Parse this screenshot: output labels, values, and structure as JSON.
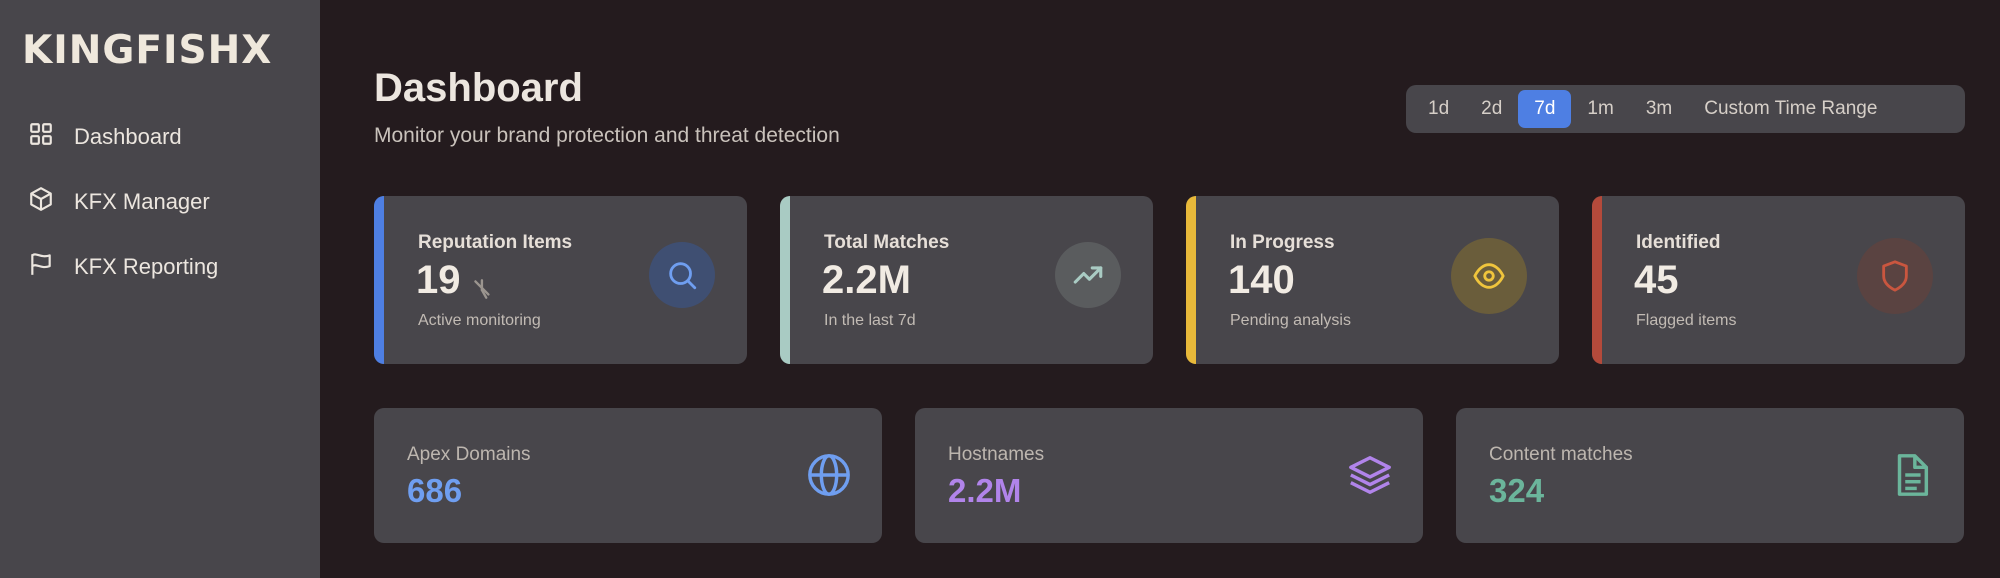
{
  "brand": {
    "logo_text": "KINGFISHX"
  },
  "sidebar": {
    "items": [
      {
        "label": "Dashboard",
        "icon": "grid-icon"
      },
      {
        "label": "KFX Manager",
        "icon": "cube-icon"
      },
      {
        "label": "KFX Reporting",
        "icon": "flag-icon"
      }
    ]
  },
  "header": {
    "title": "Dashboard",
    "subtitle": "Monitor your brand protection and threat detection"
  },
  "time_range": {
    "options": [
      "1d",
      "2d",
      "7d",
      "1m",
      "3m",
      "Custom Time Range"
    ],
    "selected": "7d"
  },
  "stats": [
    {
      "label": "Reputation Items",
      "value": "19",
      "note": "Active monitoring",
      "icon": "search-icon",
      "accent": "#4e7fe3"
    },
    {
      "label": "Total Matches",
      "value": "2.2M",
      "note": "In the last 7d",
      "icon": "trending-up-icon",
      "accent": "#a9cbc3"
    },
    {
      "label": "In Progress",
      "value": "140",
      "note": "Pending analysis",
      "icon": "eye-icon",
      "accent": "#e8b93a"
    },
    {
      "label": "Identified",
      "value": "45",
      "note": "Flagged items",
      "icon": "shield-icon",
      "accent": "#b44a3b"
    }
  ],
  "metrics": [
    {
      "label": "Apex Domains",
      "value": "686",
      "icon": "globe-icon",
      "color": "#6f9ef0"
    },
    {
      "label": "Hostnames",
      "value": "2.2M",
      "icon": "layers-icon",
      "color": "#b184ea"
    },
    {
      "label": "Content matches",
      "value": "324",
      "icon": "document-icon",
      "color": "#6bb59b"
    }
  ]
}
